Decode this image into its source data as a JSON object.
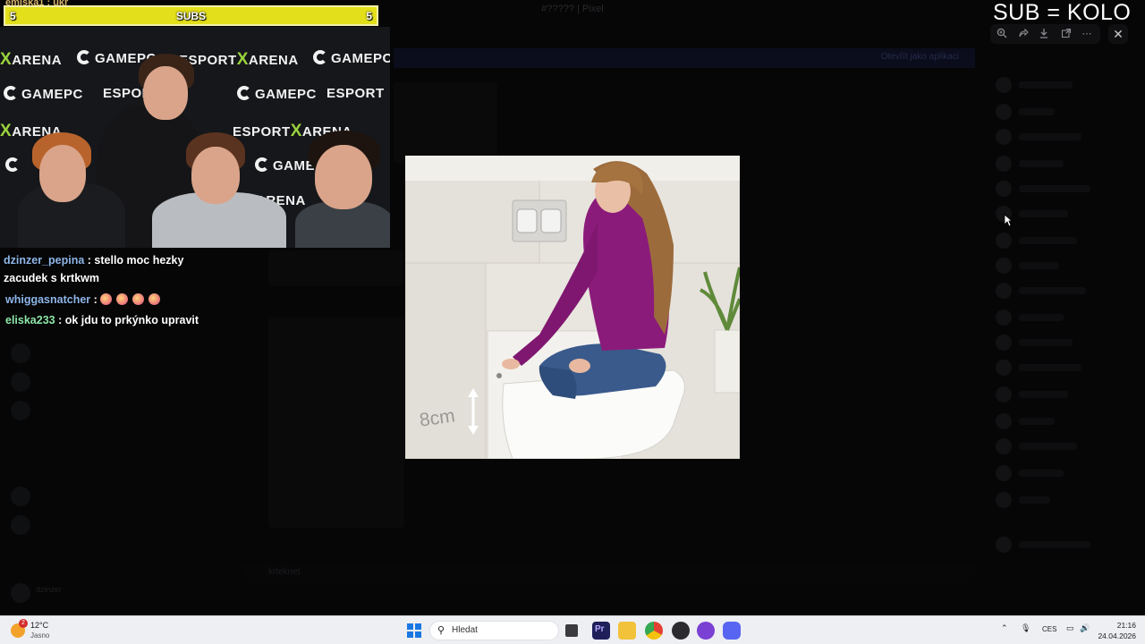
{
  "background_app": {
    "window_title": "#????? | Pixel",
    "banner_text": "Otevřít jako aplikaci",
    "composer_placeholder": "krteknet",
    "user_name": "dzinzer"
  },
  "overlay": {
    "corner_name": "emiska1 : ukr",
    "subs_bar": {
      "left_count": "5",
      "label": "SUBS",
      "right_count": "5"
    },
    "sub_kolo": "SUB = KOLO",
    "camera_banner_brands": [
      "ESPORT",
      "ARENA",
      "GAMEPC"
    ]
  },
  "chat": [
    {
      "user": "dzinzer_pepina",
      "message": "stello moc hezky zacudek s krtkwm",
      "color": "#8fb6e8"
    },
    {
      "user": "whiggasnatcher",
      "message": "",
      "emote_count": 4,
      "color": "#8fb6e8"
    },
    {
      "user": "eliska233",
      "message": "ok jdu to prkýnko upravit",
      "color": "#8fe6a8"
    }
  ],
  "viewer": {
    "toolbar_icons": [
      "zoom-in-icon",
      "forward-icon",
      "download-icon",
      "open-external-icon",
      "more-icon"
    ],
    "close_icon": "close-icon",
    "image": {
      "measure_label": "8cm"
    }
  },
  "taskbar": {
    "weather": {
      "temp": "12°C",
      "condition": "Jasno",
      "badge": "2"
    },
    "search_placeholder": "Hledat",
    "language": "CES",
    "time": "21:16",
    "date": "24.04.2026",
    "apps": [
      "file-explorer-icon",
      "premiere-icon",
      "folder-icon",
      "chrome-icon",
      "app-icon",
      "browser-icon",
      "discord-icon"
    ]
  },
  "colors": {
    "subs_bar": "#e3e01b",
    "taskbar": "#eeeff3",
    "shirt": "#8b1b7a",
    "jeans": "#3a5a8c"
  }
}
